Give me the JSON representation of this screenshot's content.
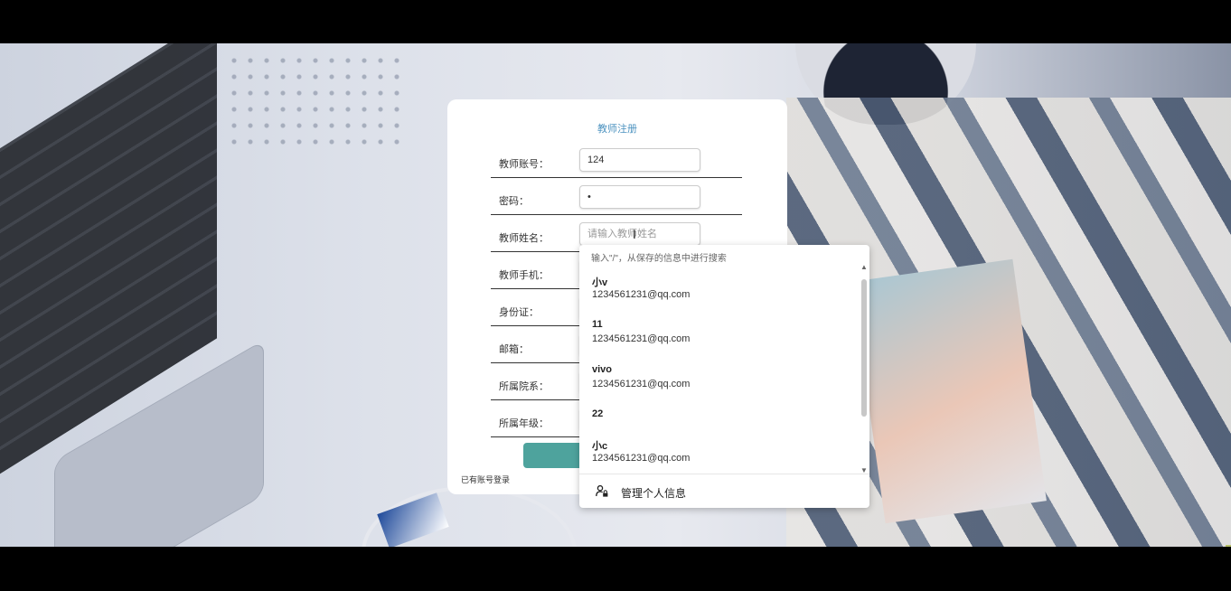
{
  "form": {
    "title": "教师注册",
    "fields": [
      {
        "label": "教师账号：",
        "value": "124",
        "placeholder": ""
      },
      {
        "label": "密码：",
        "value": "•",
        "placeholder": ""
      },
      {
        "label": "教师姓名：",
        "value": "",
        "placeholder": "请输入教师姓名"
      },
      {
        "label": "教师手机：",
        "value": "",
        "placeholder": ""
      },
      {
        "label": "身份证：",
        "value": "",
        "placeholder": ""
      },
      {
        "label": "邮箱：",
        "value": "",
        "placeholder": ""
      },
      {
        "label": "所属院系：",
        "value": "",
        "placeholder": ""
      },
      {
        "label": "所属年级：",
        "value": "",
        "placeholder": ""
      }
    ],
    "submit_label": "",
    "login_link": "已有账号登录"
  },
  "autofill": {
    "hint": "输入\"/\"，从保存的信息中进行搜索",
    "items": [
      {
        "name": "小v",
        "email": "1234561231@qq.com"
      },
      {
        "name": "11",
        "email": "1234561231@qq.com"
      },
      {
        "name": "vivo",
        "email": "1234561231@qq.com"
      },
      {
        "name": "22",
        "email": ""
      },
      {
        "name": "小c",
        "email": "1234561231@qq.com"
      }
    ],
    "footer_label": "管理个人信息",
    "footer_icon": "person-lock-icon"
  },
  "colors": {
    "title": "#4d93c0",
    "submit": "#4ea39d"
  }
}
